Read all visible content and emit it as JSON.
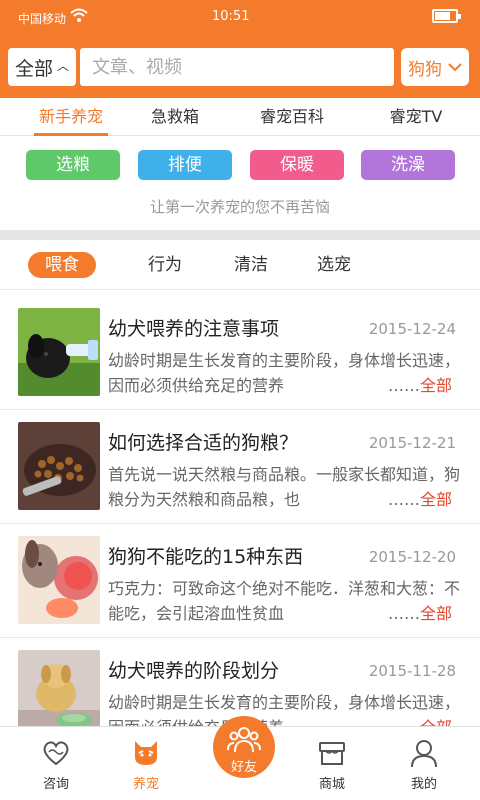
{
  "status_bar": {
    "carrier": "中国移动",
    "time": "10:51",
    "battery_level": 0.7
  },
  "header": {
    "scope_label": "全部",
    "search_placeholder": "文章、视频",
    "pet_label": "狗狗"
  },
  "top_tabs": [
    {
      "label": "新手养宠",
      "active": true
    },
    {
      "label": "急救箱",
      "active": false
    },
    {
      "label": "睿宠百科",
      "active": false
    },
    {
      "label": "睿宠TV",
      "active": false
    }
  ],
  "categories": [
    {
      "label": "选粮",
      "color": "#5fc96a"
    },
    {
      "label": "排便",
      "color": "#3fb0ea"
    },
    {
      "label": "保暖",
      "color": "#f25c8d"
    },
    {
      "label": "洗澡",
      "color": "#b275d9"
    }
  ],
  "tagline": "让第一次养宠的您不再苦恼",
  "sub_tabs": [
    {
      "label": "喂食",
      "active": true
    },
    {
      "label": "行为",
      "active": false
    },
    {
      "label": "清洁",
      "active": false
    },
    {
      "label": "选宠",
      "active": false
    }
  ],
  "articles": [
    {
      "title": "幼犬喂养的注意事项",
      "date": "2015-12-24",
      "summary": "幼龄时期是生长发育的主要阶段，身体增长迅速，因而必须供给充足的营养",
      "more_dots": "……",
      "more_label": "全部"
    },
    {
      "title": "如何选择合适的狗粮？",
      "date": "2015-12-21",
      "summary": "首先说一说天然粮与商品粮。一般家长都知道，狗粮分为天然粮和商品粮，也",
      "more_dots": "……",
      "more_label": "全部"
    },
    {
      "title": "狗狗不能吃的15种东西",
      "date": "2015-12-20",
      "summary": "巧克力：可致命这个绝对不能吃．洋葱和大葱：不能吃，会引起溶血性贫血",
      "more_dots": "……",
      "more_label": "全部"
    },
    {
      "title": "幼犬喂养的阶段划分",
      "date": "2015-11-28",
      "summary": "幼龄时期是生长发育的主要阶段，身体增长迅速，因而必须供给充足的营养，",
      "more_dots": "……",
      "more_label": "全部"
    }
  ],
  "bottom_nav": [
    {
      "label": "咨询",
      "icon": "heart-chat-icon",
      "active": false
    },
    {
      "label": "养宠",
      "icon": "cat-face-icon",
      "active": true
    },
    {
      "label": "好友",
      "icon": "friends-icon",
      "active": false
    },
    {
      "label": "商城",
      "icon": "shop-icon",
      "active": false
    },
    {
      "label": "我的",
      "icon": "user-icon",
      "active": false
    }
  ],
  "colors": {
    "accent": "#f47b2c",
    "link_red": "#e8472b"
  }
}
